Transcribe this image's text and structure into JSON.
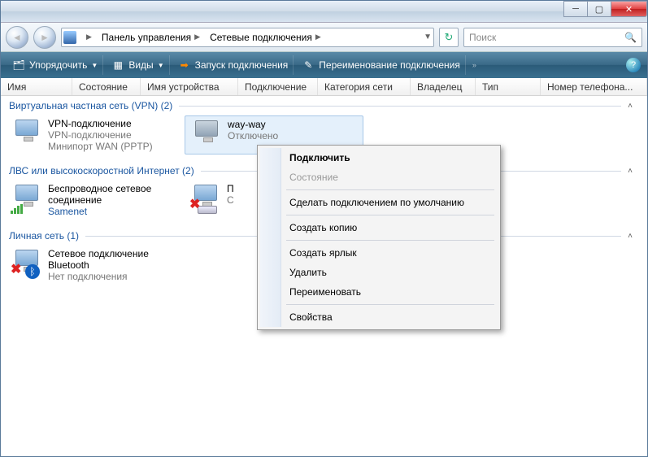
{
  "breadcrumb": {
    "control_panel": "Панель управления",
    "network_connections": "Сетевые подключения"
  },
  "search": {
    "placeholder": "Поиск"
  },
  "toolbar": {
    "organize": "Упорядочить",
    "views": "Виды",
    "start_connection": "Запуск подключения",
    "rename_connection": "Переименование подключения"
  },
  "columns": {
    "name": "Имя",
    "status": "Состояние",
    "device_name": "Имя устройства",
    "connection": "Подключение",
    "network_category": "Категория сети",
    "owner": "Владелец",
    "type": "Тип",
    "phone_number": "Номер телефона..."
  },
  "groups": {
    "vpn": {
      "label": "Виртуальная частная сеть (VPN) (2)"
    },
    "lan": {
      "label": "ЛВС или высокоскоростной Интернет (2)"
    },
    "personal": {
      "label": "Личная сеть (1)"
    }
  },
  "connections": {
    "vpn1": {
      "title": "VPN-подключение",
      "sub1": "VPN-подключение",
      "sub2": "Минипорт WAN (PPTP)"
    },
    "vpn2": {
      "title": "way-way",
      "sub1": "Отключено",
      "sub2": ""
    },
    "wifi": {
      "title": "Беспроводное сетевое соединение",
      "sub1": "",
      "sub2": "Samenet"
    },
    "lan2": {
      "title": "П",
      "sub1": "С",
      "sub2": ""
    },
    "bt": {
      "title": "Сетевое подключение Bluetooth",
      "sub1": "",
      "sub2": "Нет подключения"
    }
  },
  "context_menu": {
    "connect": "Подключить",
    "status": "Состояние",
    "make_default": "Сделать подключением по умолчанию",
    "create_copy": "Создать копию",
    "create_shortcut": "Создать ярлык",
    "delete": "Удалить",
    "rename": "Переименовать",
    "properties": "Свойства"
  }
}
